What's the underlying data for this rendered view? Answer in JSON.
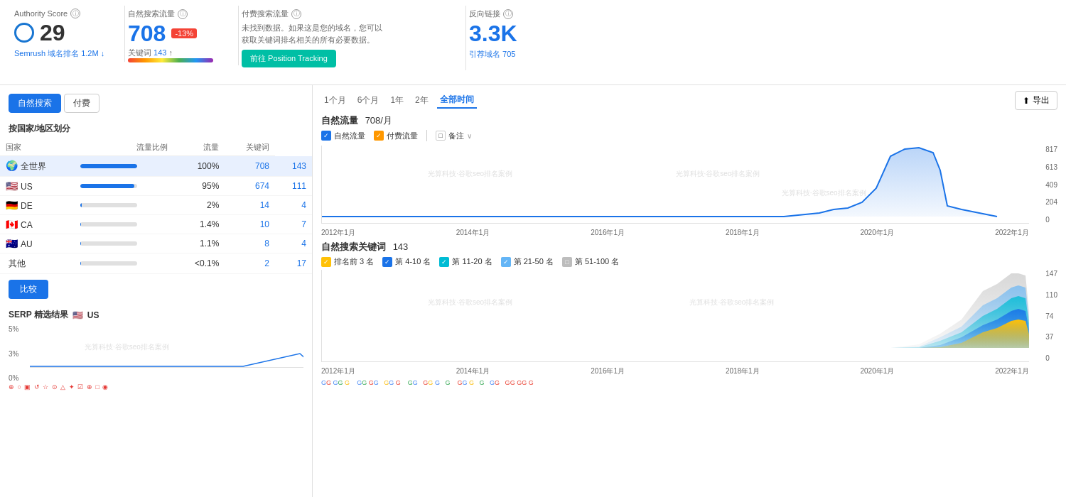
{
  "metrics": {
    "authority": {
      "title": "Authority Score",
      "value": "29",
      "sub_label": "Semrush 域名排名",
      "sub_value": "1.2M",
      "sub_arrow": "↓"
    },
    "organic": {
      "title": "自然搜索流量",
      "value": "708",
      "badge": "-13%",
      "kw_label": "关键词",
      "kw_value": "143",
      "kw_arrow": "↑"
    },
    "paid": {
      "title": "付费搜索流量",
      "description": "未找到数据。如果这是您的域名，您可以获取关键词排名相关的所有必要数据。",
      "btn_label": "前往 Position Tracking"
    },
    "backlinks": {
      "title": "反向链接",
      "value": "3.3K",
      "ref_label": "引荐域名",
      "ref_value": "705"
    }
  },
  "left_panel": {
    "tabs": [
      "自然搜索",
      "付费"
    ],
    "active_tab": 0,
    "section_title": "按国家/地区划分",
    "table": {
      "headers": [
        "国家",
        "流量比例",
        "流量",
        "关键词"
      ],
      "rows": [
        {
          "flag": "🌍",
          "name": "全世界",
          "bar_pct": 100,
          "pct_label": "100%",
          "traffic": "708",
          "keywords": "143",
          "highlight": true
        },
        {
          "flag": "🇺🇸",
          "name": "US",
          "bar_pct": 95,
          "pct_label": "95%",
          "traffic": "674",
          "keywords": "111",
          "highlight": false
        },
        {
          "flag": "🇩🇪",
          "name": "DE",
          "bar_pct": 2,
          "pct_label": "2%",
          "traffic": "14",
          "keywords": "4",
          "highlight": false
        },
        {
          "flag": "🇨🇦",
          "name": "CA",
          "bar_pct": 1.4,
          "pct_label": "1.4%",
          "traffic": "10",
          "keywords": "7",
          "highlight": false
        },
        {
          "flag": "🇦🇺",
          "name": "AU",
          "bar_pct": 1.1,
          "pct_label": "1.1%",
          "traffic": "8",
          "keywords": "4",
          "highlight": false
        },
        {
          "flag": "",
          "name": "其他",
          "bar_pct": 0.1,
          "pct_label": "<0.1%",
          "traffic": "2",
          "keywords": "17",
          "highlight": false
        }
      ]
    },
    "compare_btn": "比较",
    "serp_title": "SERP 精选结果",
    "serp_flag": "🇺🇸",
    "serp_country": "US",
    "serp_y_labels": [
      "5%",
      "3%",
      "0%"
    ]
  },
  "right_panel": {
    "time_options": [
      "1个月",
      "6个月",
      "1年",
      "2年",
      "全部时间"
    ],
    "active_time": "全部时间",
    "export_label": "导出",
    "traffic_section": {
      "title": "自然流量",
      "value": "708/月",
      "legend": [
        {
          "color": "blue",
          "label": "自然流量",
          "checked": true
        },
        {
          "color": "orange",
          "label": "付费流量",
          "checked": true
        },
        {
          "label": "备注",
          "checked": false
        }
      ],
      "y_labels": [
        "817",
        "613",
        "409",
        "204",
        "0"
      ],
      "x_labels": [
        "2012年1月",
        "2014年1月",
        "2016年1月",
        "2018年1月",
        "2020年1月",
        "2022年1月"
      ]
    },
    "keywords_section": {
      "title": "自然搜索关键词",
      "value": "143",
      "legend": [
        {
          "color": "yellow",
          "label": "排名前 3 名"
        },
        {
          "color": "blue",
          "label": "第 4-10 名"
        },
        {
          "color": "teal",
          "label": "第 11-20 名"
        },
        {
          "color": "lblue",
          "label": "第 21-50 名"
        },
        {
          "color": "lgray",
          "label": "第 51-100 名"
        }
      ],
      "y_labels": [
        "147",
        "110",
        "74",
        "37",
        "0"
      ],
      "x_labels": [
        "2012年1月",
        "2014年1月",
        "2016年1月",
        "2018年1月",
        "2020年1月",
        "2022年1月"
      ]
    }
  },
  "watermarks": [
    "光算科技·谷歌seo排名案例",
    "光算科技·谷歌seo排名案例",
    "光算科技·谷歌seo排名案例"
  ]
}
